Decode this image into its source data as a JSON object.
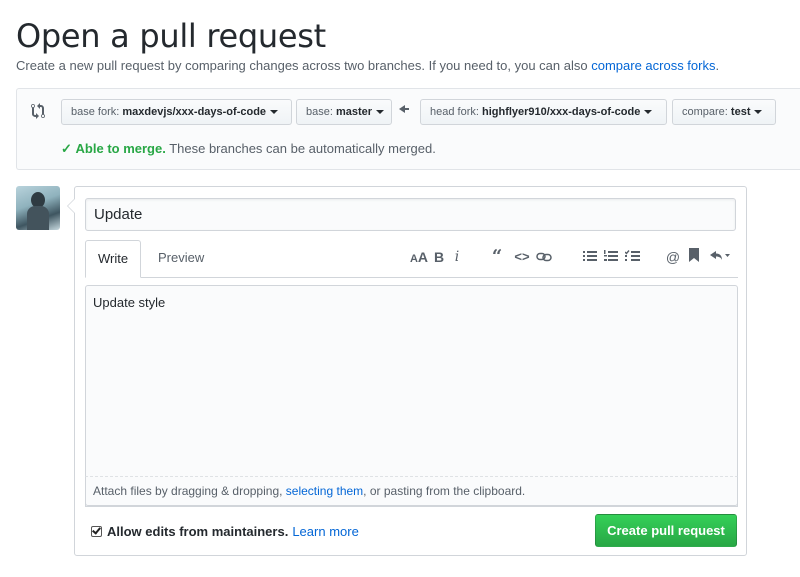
{
  "page": {
    "title": "Open a pull request",
    "subtitle_text": "Create a new pull request by comparing changes across two branches. If you need to, you can also ",
    "subtitle_link": "compare across forks",
    "subtitle_end": "."
  },
  "compare": {
    "icon": "git-compare-icon",
    "base_fork_label": "base fork: ",
    "base_fork_value": "maxdevjs/xxx-days-of-code",
    "base_label": "base: ",
    "base_value": "master",
    "arrow": "🡐",
    "head_fork_label": "head fork: ",
    "head_fork_value": "highflyer910/xxx-days-of-code",
    "compare_label": "compare: ",
    "compare_value": "test",
    "merge_check": "✓",
    "merge_ok": "Able to merge.",
    "merge_text": " These branches can be automatically merged.",
    "merge_color": "#28a745"
  },
  "composer": {
    "title_value": "Update",
    "tabs": [
      "Write",
      "Preview"
    ],
    "toolbar": [
      {
        "name": "header-icon",
        "glyph": "AA"
      },
      {
        "name": "bold-icon",
        "glyph": "B"
      },
      {
        "name": "italic-icon",
        "glyph": "i"
      },
      {
        "name": "quote-icon",
        "glyph": "❝"
      },
      {
        "name": "code-icon",
        "glyph": "<>"
      },
      {
        "name": "link-icon",
        "glyph": "⊖"
      },
      {
        "name": "unordered-list-icon",
        "glyph": "☰"
      },
      {
        "name": "ordered-list-icon",
        "glyph": "☷"
      },
      {
        "name": "task-list-icon",
        "glyph": "☑"
      },
      {
        "name": "mention-icon",
        "glyph": "@"
      },
      {
        "name": "saved-reply-icon",
        "glyph": "🔖"
      },
      {
        "name": "reply-icon",
        "glyph": "↶"
      }
    ],
    "body_value": "Update style",
    "attach_text_1": "Attach files by dragging & dropping, ",
    "attach_link": "selecting them",
    "attach_text_2": ", or pasting from the clipboard.",
    "allow_edits_label": "Allow edits from maintainers.",
    "learn_more": "Learn more",
    "submit_label": "Create pull request",
    "submit_color": "#28a745"
  }
}
